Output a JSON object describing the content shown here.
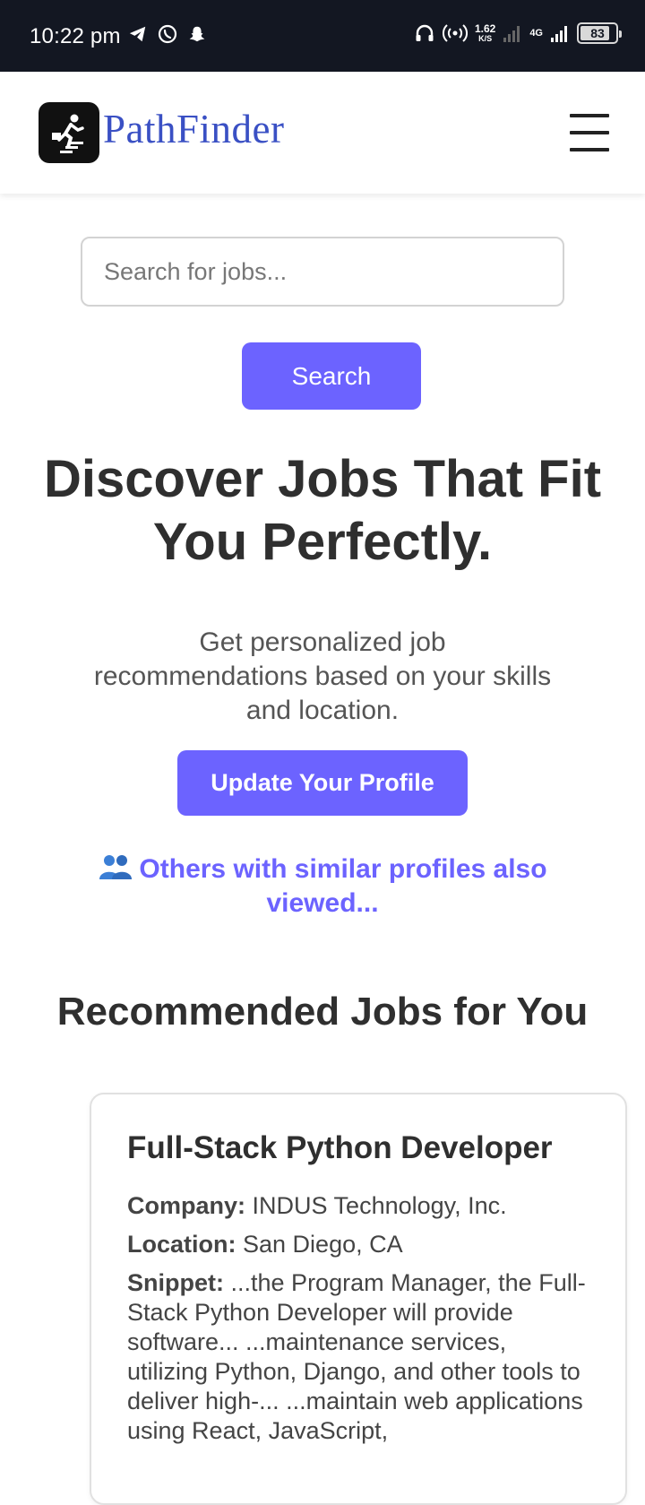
{
  "status_bar": {
    "time": "10:22 pm",
    "speed_value": "1.62",
    "speed_unit": "K/S",
    "network": "4G",
    "battery": "83",
    "battery_level": 0.83
  },
  "nav": {
    "brand": "PathFinder"
  },
  "search": {
    "placeholder": "Search for jobs...",
    "button": "Search"
  },
  "hero": {
    "title": "Discover Jobs That Fit You Perfectly.",
    "subtitle": "Get personalized job recommendations based on your skills and location.",
    "profile_button": "Update Your Profile",
    "similar_link": "Others with similar profiles also viewed..."
  },
  "recommended": {
    "title": "Recommended Jobs for You",
    "jobs": [
      {
        "title": "Full-Stack Python Developer",
        "company_label": "Company:",
        "company": "INDUS Technology, Inc.",
        "location_label": "Location:",
        "location": "San Diego, CA",
        "snippet_label": "Snippet:",
        "snippet": "...the Program Manager, the Full-Stack Python Developer will provide software... ...maintenance services, utilizing Python, Django, and other tools to deliver high-... ...maintain web applications using React, JavaScript,"
      }
    ]
  }
}
